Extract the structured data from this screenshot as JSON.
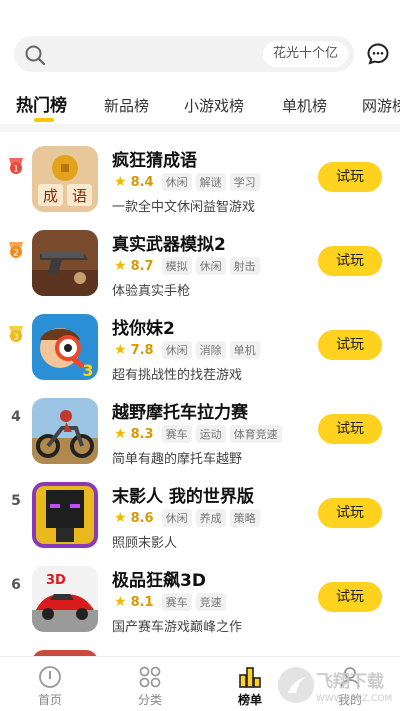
{
  "search": {
    "hint": "花光十个亿"
  },
  "tabs": [
    {
      "label": "热门榜"
    },
    {
      "label": "新品榜"
    },
    {
      "label": "小游戏榜"
    },
    {
      "label": "单机榜"
    },
    {
      "label": "网游榜"
    }
  ],
  "games": [
    {
      "rank": "1",
      "title": "疯狂猜成语",
      "score": "8.4",
      "tags": [
        "休闲",
        "解谜",
        "学习"
      ],
      "desc": "一款全中文休闲益智游戏",
      "play": "试玩"
    },
    {
      "rank": "2",
      "title": "真实武器模拟2",
      "score": "8.7",
      "tags": [
        "模拟",
        "休闲",
        "射击"
      ],
      "desc": "体验真实手枪",
      "play": "试玩"
    },
    {
      "rank": "3",
      "title": "找你妹2",
      "score": "7.8",
      "tags": [
        "休闲",
        "消除",
        "单机"
      ],
      "desc": "超有挑战性的找茬游戏",
      "play": "试玩"
    },
    {
      "rank": "4",
      "title": "越野摩托车拉力赛",
      "score": "8.3",
      "tags": [
        "赛车",
        "运动",
        "体育竞速"
      ],
      "desc": "简单有趣的摩托车越野",
      "play": "试玩"
    },
    {
      "rank": "5",
      "title": "末影人 我的世界版",
      "score": "8.6",
      "tags": [
        "休闲",
        "养成",
        "策略"
      ],
      "desc": "照顾末影人",
      "play": "试玩"
    },
    {
      "rank": "6",
      "title": "极品狂飙3D",
      "score": "8.1",
      "tags": [
        "赛车",
        "竞速"
      ],
      "desc": "国产赛车游戏巅峰之作",
      "play": "试玩"
    }
  ],
  "thumb_texts": {
    "idiom_left": "成",
    "idiom_right": "语",
    "racing_badge": "3D"
  },
  "bottom_nav": [
    {
      "label": "首页"
    },
    {
      "label": "分类"
    },
    {
      "label": "榜单"
    },
    {
      "label": "我的"
    }
  ],
  "watermark": {
    "text": "飞翔下载",
    "url": "WWW.FXXZ.COM"
  },
  "colors": {
    "accent": "#ffd21f",
    "score": "#d79a00",
    "star": "#f5b800"
  }
}
